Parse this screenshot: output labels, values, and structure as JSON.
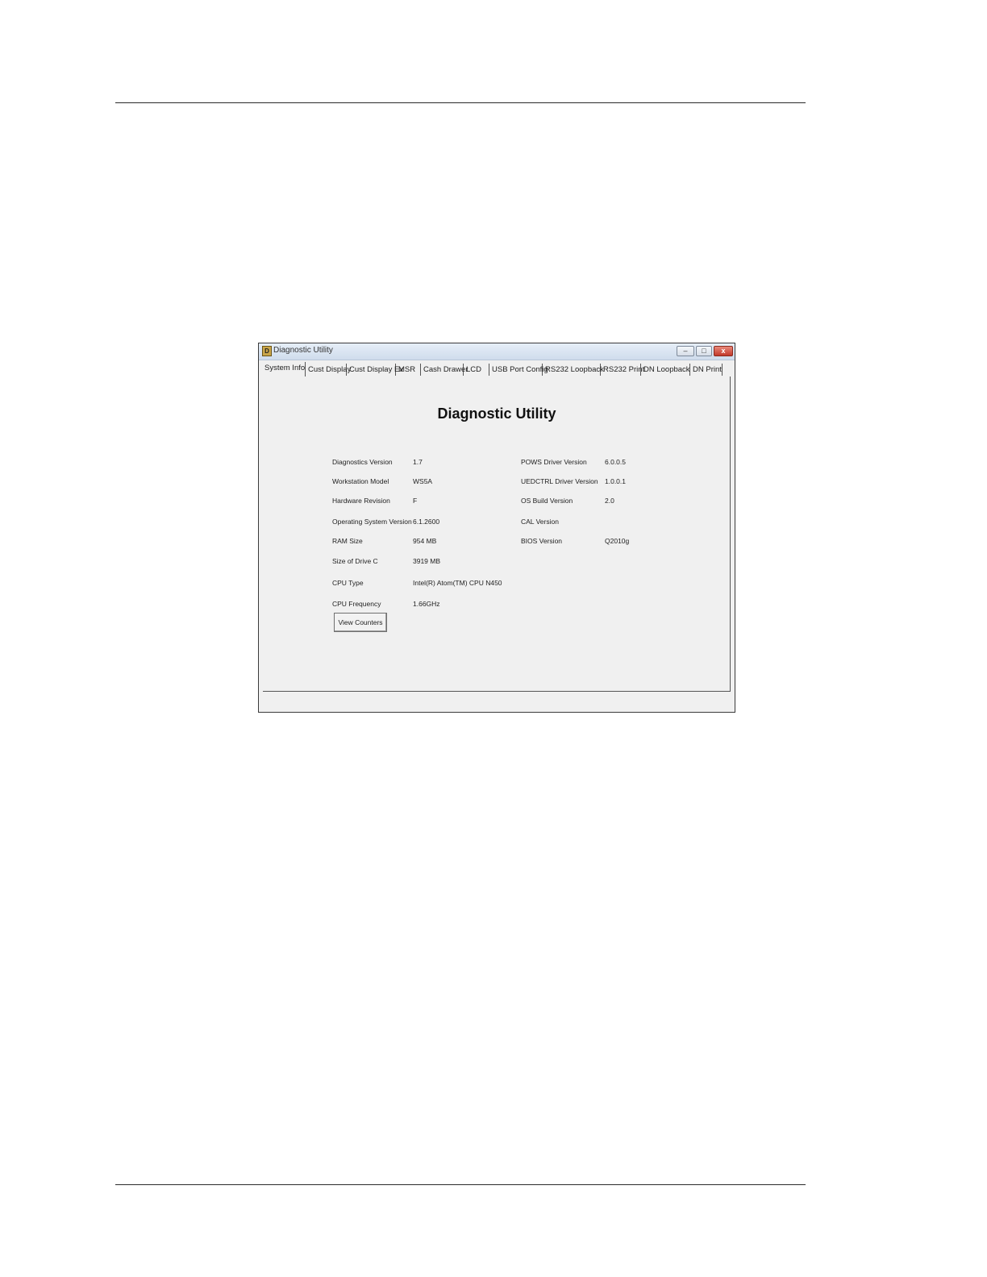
{
  "window": {
    "title": "Diagnostic Utility",
    "buttons": {
      "minimize": "–",
      "maximize": "□",
      "close": "x"
    }
  },
  "tabs": [
    "System Info",
    "Cust Display",
    "Cust Display Ex",
    "MSR",
    "Cash Drawer",
    "LCD",
    "USB Port Config",
    "RS232 Loopback",
    "RS232 Print",
    "DN Loopback",
    "DN Print"
  ],
  "panel": {
    "heading": "Diagnostic Utility",
    "left_fields": [
      {
        "label": "Diagnostics Version",
        "value": "1.7"
      },
      {
        "label": "Workstation Model",
        "value": "WS5A"
      },
      {
        "label": "Hardware Revision",
        "value": "F"
      },
      {
        "label": "Operating System Version",
        "value": "6.1.2600"
      },
      {
        "label": "RAM Size",
        "value": "954 MB"
      },
      {
        "label": "Size of Drive C",
        "value": "3919 MB"
      },
      {
        "label": "CPU Type",
        "value": "Intel(R) Atom(TM) CPU N450"
      },
      {
        "label": "CPU Frequency",
        "value": "1.66GHz"
      }
    ],
    "right_fields": [
      {
        "label": "POWS Driver Version",
        "value": "6.0.0.5"
      },
      {
        "label": "UEDCTRL Driver Version",
        "value": "1.0.0.1"
      },
      {
        "label": "OS Build Version",
        "value": "2.0"
      },
      {
        "label": "CAL Version",
        "value": ""
      },
      {
        "label": "BIOS Version",
        "value": "Q2010g"
      }
    ],
    "view_counters_label": "View Counters"
  }
}
